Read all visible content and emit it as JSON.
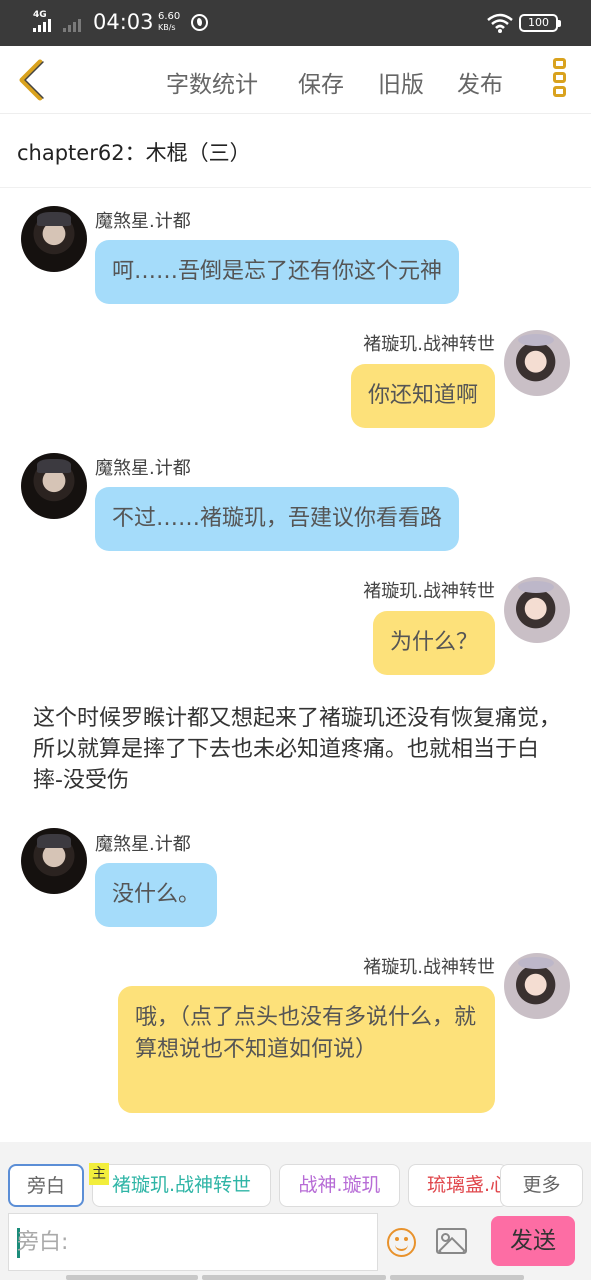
{
  "status_bar": {
    "network": "4G",
    "time": "04:03",
    "speed_value": "6.60",
    "speed_unit": "KB/s",
    "battery": "100"
  },
  "toolbar": {
    "back_icon": "chevron-left-icon",
    "word_count": "字数统计",
    "save": "保存",
    "old_version": "旧版",
    "publish": "发布",
    "more_icon": "more-vertical-icon",
    "accent_color": "#d9a21e"
  },
  "chapter": {
    "title": "chapter62：木棍（三）"
  },
  "messages": [
    {
      "side": "left",
      "name": "魔煞星.计都",
      "text": "呵……吾倒是忘了还有你这个元神"
    },
    {
      "side": "right",
      "name": "褚璇玑.战神转世",
      "text": "你还知道啊"
    },
    {
      "side": "left",
      "name": "魔煞星.计都",
      "text": "不过……褚璇玑，吾建议你看看路"
    },
    {
      "side": "right",
      "name": "褚璇玑.战神转世",
      "text": "为什么？"
    },
    {
      "side": "left",
      "name": "魔煞星.计都",
      "text": "没什么。"
    },
    {
      "side": "right",
      "name": "褚璇玑.战神转世",
      "text": "哦，（点了点头也没有多说什么，就算想说也不知道如何说）"
    }
  ],
  "narration": "这个时候罗睺计都又想起来了褚璇玑还没有恢复痛觉，所以就算是摔了下去也未必知道疼痛。也就相当于白摔-没受伤",
  "colors": {
    "left_bubble": "#a5dcfa",
    "right_bubble": "#fde17a",
    "send_button": "#fd6da4"
  },
  "roles": {
    "items": [
      {
        "label": "旁白",
        "color": "#666666"
      },
      {
        "label": "褚璇玑.战神转世",
        "color": "#2fb5a6"
      },
      {
        "label": "战神.璇玑",
        "color": "#b76cd6"
      },
      {
        "label": "琉璃盏.心",
        "color": "#e0474c"
      }
    ],
    "main_badge": "主",
    "more": "更多"
  },
  "composer": {
    "placeholder": "旁白:",
    "emoji_icon": "emoji-icon",
    "image_icon": "image-icon",
    "send": "发送"
  }
}
